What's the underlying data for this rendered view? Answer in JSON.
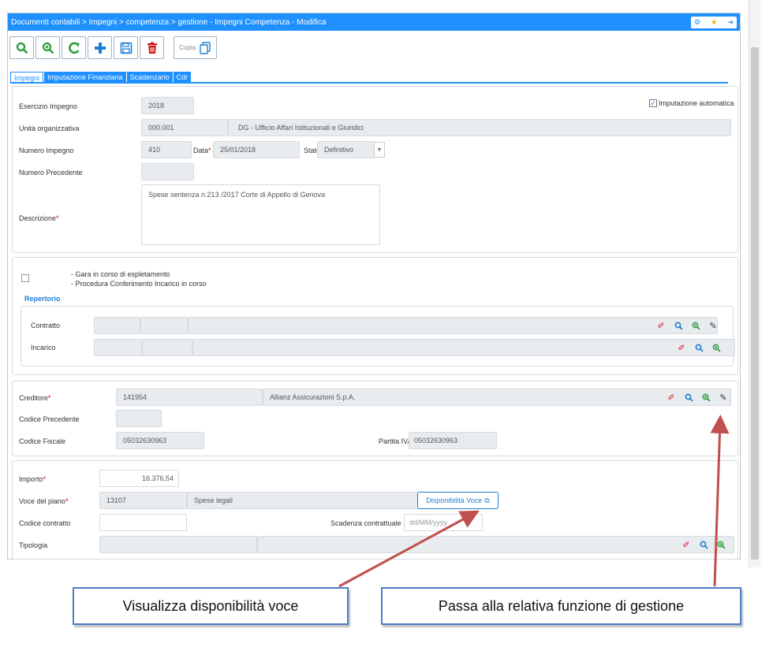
{
  "window": {
    "breadcrumb": "Documenti contabili > Impegni > competenza > gestione - Impegni Competenza - Modifica",
    "controls": [
      "gear-icon",
      "star-icon",
      "exit-icon"
    ]
  },
  "toolbar": {
    "buttons": [
      "search-icon",
      "zoom-in-icon",
      "refresh-icon",
      "add-icon",
      "save-icon",
      "delete-icon"
    ],
    "copy_label": "Copia"
  },
  "tabs": [
    "Impegni",
    "Imputazione Finanziaria",
    "Scadenzario",
    "Cdr"
  ],
  "impegno": {
    "esercizio_label": "Esercizio Impegno",
    "esercizio_value": "2018",
    "imputazione_label": "Imputazione automatica",
    "imputazione_checked": true,
    "unita_label": "Unità organizzativa",
    "unita_code": "000.001",
    "unita_desc": "DG - Ufficio Affari Istituzionali e Giuridici",
    "numero_label": "Numero Impegno",
    "numero_value": "410",
    "data_label": "Data",
    "data_value": "25/01/2018",
    "stato_label": "Stato",
    "stato_value": "Definitivo",
    "numero_prec_label": "Numero Precedente",
    "descrizione_label": "Descrizione",
    "descrizione_value": "Spese sentenza  n.213 /2017  Corte di Appello di Genova"
  },
  "gara": {
    "line1": "- Gara in corso di espletamento",
    "line2": "- Procedura Conferimento Incarico in corso",
    "repertorio_label": "Repertorio",
    "contratto_label": "Contratto",
    "incarico_label": "Incarico"
  },
  "creditore": {
    "label": "Creditore",
    "code": "141954",
    "name": "Allianz  Assicurazioni S.p.A.",
    "codice_prec_label": "Codice Precedente",
    "cf_label": "Codice Fiscale",
    "cf_value": "05032630963",
    "piva_label": "Partita IVA",
    "piva_value": "05032630963"
  },
  "importo": {
    "label": "Importo",
    "value": "16.376,54",
    "voce_label": "Voce del piano",
    "voce_code": "13107",
    "voce_desc": "Spese legali",
    "disp_button": "Disponibilità Voce",
    "codice_contratto_label": "Codice contratto",
    "scadenza_label": "Scadenza contrattuale",
    "scadenza_placeholder": "dd/MM/yyyy",
    "tipologia_label": "Tipologia"
  },
  "callouts": {
    "left": "Visualizza disponibilità voce",
    "right": "Passa alla relativa funzione di gestione"
  },
  "colors": {
    "accent": "#1e90ff",
    "arrow": "#c0504d",
    "callout_border": "#4c7cc6"
  }
}
